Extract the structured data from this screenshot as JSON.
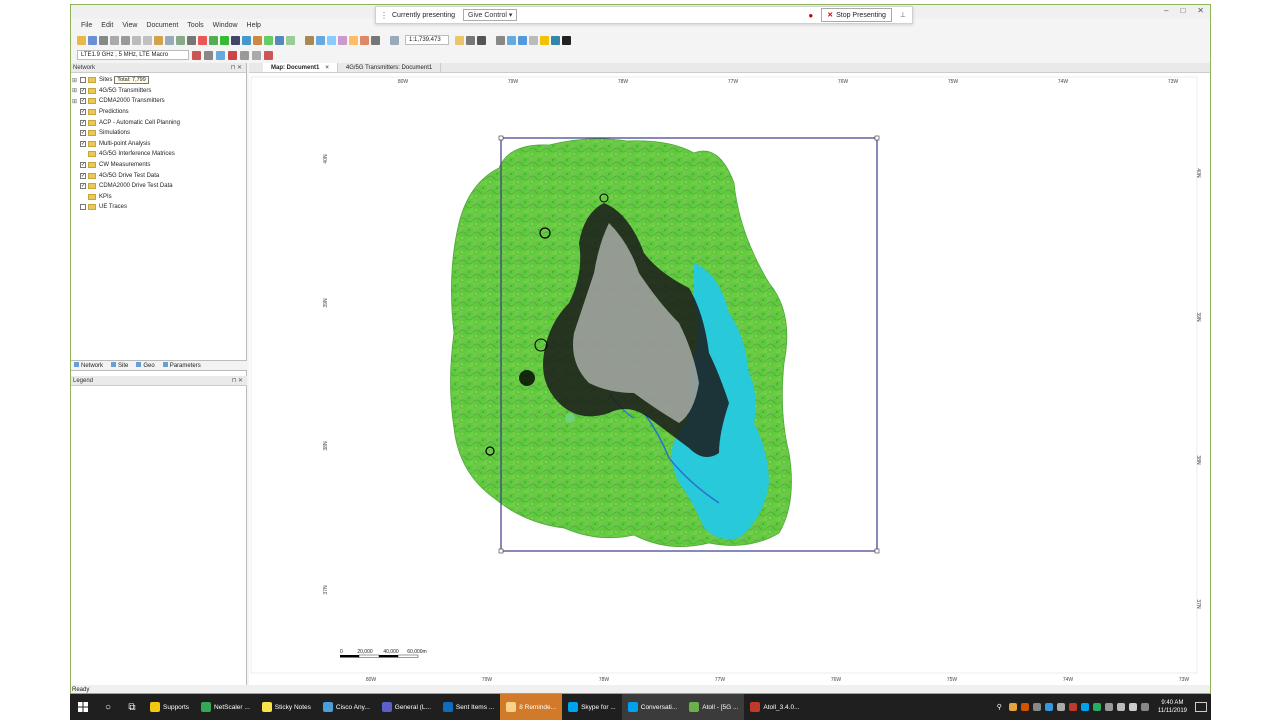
{
  "menu": [
    "File",
    "Edit",
    "View",
    "Document",
    "Tools",
    "Window",
    "Help"
  ],
  "presenting": {
    "status": "Currently presenting",
    "give_control": "Give Control ▾",
    "stop": "Stop Presenting"
  },
  "toolbar": {
    "technology": "LTE1.9 GHz , 5 MHz, LTE Macro",
    "scale": "1:1,739,473"
  },
  "network_panel": {
    "title": "Network",
    "tooltip": "Total: 7,799",
    "items": [
      {
        "label": "Sites",
        "expand": true,
        "checked": false
      },
      {
        "label": "4G/5G Transmitters",
        "expand": true,
        "checked": true
      },
      {
        "label": "CDMA2000 Transmitters",
        "expand": true,
        "checked": true
      },
      {
        "label": "Predictions",
        "expand": false,
        "checked": true
      },
      {
        "label": "ACP - Automatic Cell Planning",
        "expand": false,
        "checked": true
      },
      {
        "label": "Simulations",
        "expand": false,
        "checked": true
      },
      {
        "label": "Multi-point Analysis",
        "expand": false,
        "checked": true
      },
      {
        "label": "4G/5G Interference Matrices",
        "expand": false,
        "checked": null
      },
      {
        "label": "CW Measurements",
        "expand": false,
        "checked": true
      },
      {
        "label": "4G/5G Drive Test Data",
        "expand": false,
        "checked": true
      },
      {
        "label": "CDMA2000 Drive Test Data",
        "expand": false,
        "checked": true
      },
      {
        "label": "KPIs",
        "expand": false,
        "checked": null
      },
      {
        "label": "UE Traces",
        "expand": false,
        "checked": false
      }
    ]
  },
  "left_tabs": [
    "Network",
    "Site",
    "Geo",
    "Parameters"
  ],
  "legend": {
    "title": "Legend"
  },
  "doc_tabs": [
    {
      "label": "Map: Document1",
      "active": true
    },
    {
      "label": "4G/5G Transmitters: Document1",
      "active": false
    }
  ],
  "map": {
    "top_ruler": [
      "80W",
      "79W",
      "78W",
      "77W",
      "76W",
      "75W",
      "74W",
      "73W"
    ],
    "bottom_ruler": [
      "80W",
      "79W",
      "78W",
      "77W",
      "76W",
      "75W",
      "74W",
      "73W"
    ],
    "left_ruler": [
      "40N",
      "39N",
      "38N",
      "37N"
    ],
    "right_ruler": [
      "40N",
      "39N",
      "38N",
      "37N"
    ],
    "scale_bar": [
      "0",
      "20,000",
      "40,000",
      "60,000m"
    ]
  },
  "status": "Ready",
  "taskbar": {
    "apps": [
      {
        "label": "Supports",
        "color": "#f2c811",
        "active": false,
        "alert": false
      },
      {
        "label": "NetScaler ...",
        "color": "#34a853",
        "active": false,
        "alert": false
      },
      {
        "label": "Sticky Notes",
        "color": "#f7e34b",
        "active": false,
        "alert": false
      },
      {
        "label": "Cisco Any...",
        "color": "#4c9ed9",
        "active": false,
        "alert": false
      },
      {
        "label": "General (L...",
        "color": "#5b5fc7",
        "active": false,
        "alert": false
      },
      {
        "label": "Sent Items ...",
        "color": "#0f6cbd",
        "active": false,
        "alert": false
      },
      {
        "label": "8 Reminde...",
        "color": "#f8d28a",
        "active": false,
        "alert": true
      },
      {
        "label": "Skype for ...",
        "color": "#00a2ed",
        "active": false,
        "alert": false
      },
      {
        "label": "Conversati...",
        "color": "#00a2ed",
        "active": true,
        "alert": false
      },
      {
        "label": "Atoll - [5G ...",
        "color": "#6ab04c",
        "active": true,
        "alert": false
      },
      {
        "label": "Atoll_3.4.0...",
        "color": "#c0392b",
        "active": false,
        "alert": false
      }
    ],
    "time": "9:40 AM",
    "date": "11/11/2019"
  }
}
